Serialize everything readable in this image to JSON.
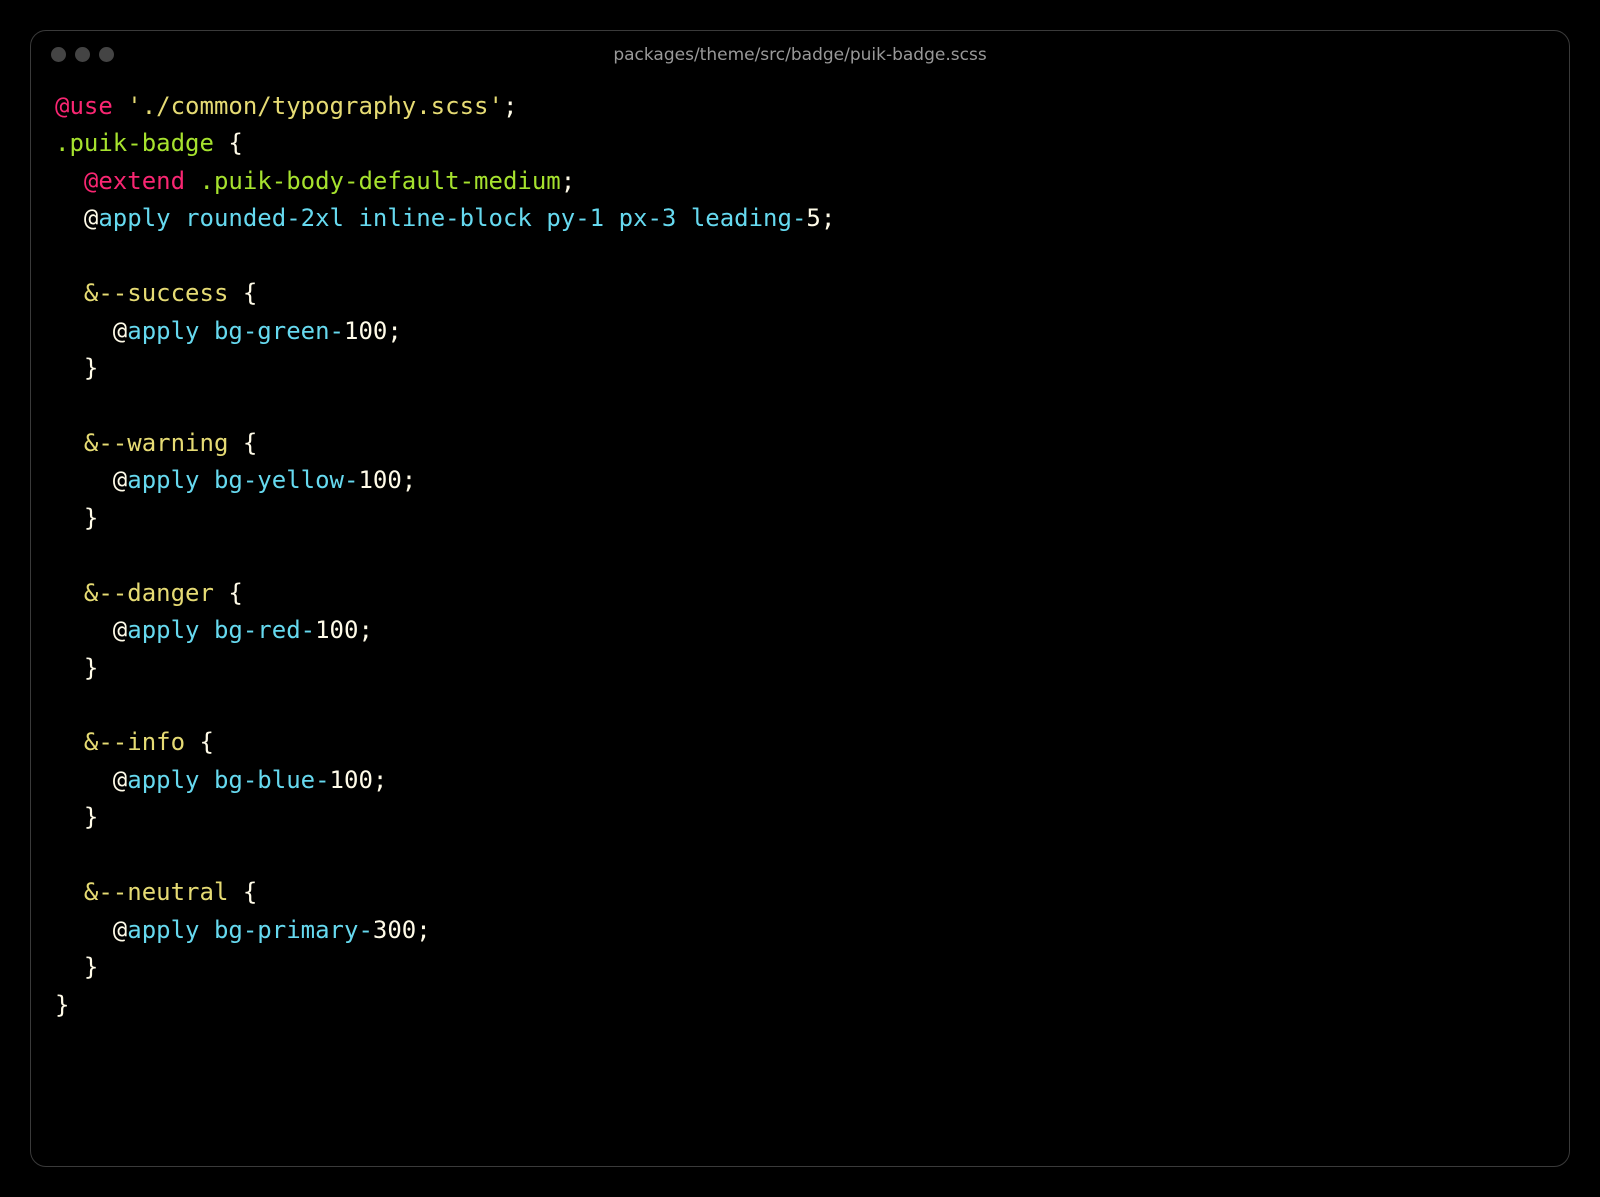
{
  "title": "packages/theme/src/badge/puik-badge.scss",
  "code": [
    {
      "ind": 0,
      "tokens": [
        [
          "red",
          "@use"
        ],
        [
          "white",
          " "
        ],
        [
          "yellow",
          "'./common/typography.scss'"
        ],
        [
          "white",
          ";"
        ]
      ]
    },
    {
      "ind": 0,
      "tokens": [
        [
          "green",
          ".puik-badge"
        ],
        [
          "white",
          " {"
        ]
      ]
    },
    {
      "ind": 1,
      "tokens": [
        [
          "red",
          "@extend"
        ],
        [
          "white",
          " "
        ],
        [
          "green",
          ".puik-body-default-medium"
        ],
        [
          "white",
          ";"
        ]
      ]
    },
    {
      "ind": 1,
      "tokens": [
        [
          "white",
          "@"
        ],
        [
          "cyan",
          "apply"
        ],
        [
          "white",
          " "
        ],
        [
          "cyan",
          "rounded-2xl"
        ],
        [
          "white",
          " "
        ],
        [
          "cyan",
          "inline-block"
        ],
        [
          "white",
          " "
        ],
        [
          "cyan",
          "py-1"
        ],
        [
          "white",
          " "
        ],
        [
          "cyan",
          "px-3"
        ],
        [
          "white",
          " "
        ],
        [
          "cyan",
          "leading-"
        ],
        [
          "white",
          "5;"
        ]
      ]
    },
    {
      "ind": 0,
      "tokens": []
    },
    {
      "ind": 1,
      "tokens": [
        [
          "yellow",
          "&--success"
        ],
        [
          "white",
          " {"
        ]
      ]
    },
    {
      "ind": 2,
      "tokens": [
        [
          "white",
          "@"
        ],
        [
          "cyan",
          "apply"
        ],
        [
          "white",
          " "
        ],
        [
          "cyan",
          "bg-green-"
        ],
        [
          "white",
          "100;"
        ]
      ]
    },
    {
      "ind": 1,
      "tokens": [
        [
          "white",
          "}"
        ]
      ]
    },
    {
      "ind": 0,
      "tokens": []
    },
    {
      "ind": 1,
      "tokens": [
        [
          "yellow",
          "&--warning"
        ],
        [
          "white",
          " {"
        ]
      ]
    },
    {
      "ind": 2,
      "tokens": [
        [
          "white",
          "@"
        ],
        [
          "cyan",
          "apply"
        ],
        [
          "white",
          " "
        ],
        [
          "cyan",
          "bg-yellow-"
        ],
        [
          "white",
          "100;"
        ]
      ]
    },
    {
      "ind": 1,
      "tokens": [
        [
          "white",
          "}"
        ]
      ]
    },
    {
      "ind": 0,
      "tokens": []
    },
    {
      "ind": 1,
      "tokens": [
        [
          "yellow",
          "&--danger"
        ],
        [
          "white",
          " {"
        ]
      ]
    },
    {
      "ind": 2,
      "tokens": [
        [
          "white",
          "@"
        ],
        [
          "cyan",
          "apply"
        ],
        [
          "white",
          " "
        ],
        [
          "cyan",
          "bg-red-"
        ],
        [
          "white",
          "100;"
        ]
      ]
    },
    {
      "ind": 1,
      "tokens": [
        [
          "white",
          "}"
        ]
      ]
    },
    {
      "ind": 0,
      "tokens": []
    },
    {
      "ind": 1,
      "tokens": [
        [
          "yellow",
          "&--info"
        ],
        [
          "white",
          " {"
        ]
      ]
    },
    {
      "ind": 2,
      "tokens": [
        [
          "white",
          "@"
        ],
        [
          "cyan",
          "apply"
        ],
        [
          "white",
          " "
        ],
        [
          "cyan",
          "bg-blue-"
        ],
        [
          "white",
          "100;"
        ]
      ]
    },
    {
      "ind": 1,
      "tokens": [
        [
          "white",
          "}"
        ]
      ]
    },
    {
      "ind": 0,
      "tokens": []
    },
    {
      "ind": 1,
      "tokens": [
        [
          "yellow",
          "&--neutral"
        ],
        [
          "white",
          " {"
        ]
      ]
    },
    {
      "ind": 2,
      "tokens": [
        [
          "white",
          "@"
        ],
        [
          "cyan",
          "apply"
        ],
        [
          "white",
          " "
        ],
        [
          "cyan",
          "bg-primary-"
        ],
        [
          "white",
          "300;"
        ]
      ]
    },
    {
      "ind": 1,
      "tokens": [
        [
          "white",
          "}"
        ]
      ]
    },
    {
      "ind": 0,
      "tokens": [
        [
          "white",
          "}"
        ]
      ]
    }
  ]
}
